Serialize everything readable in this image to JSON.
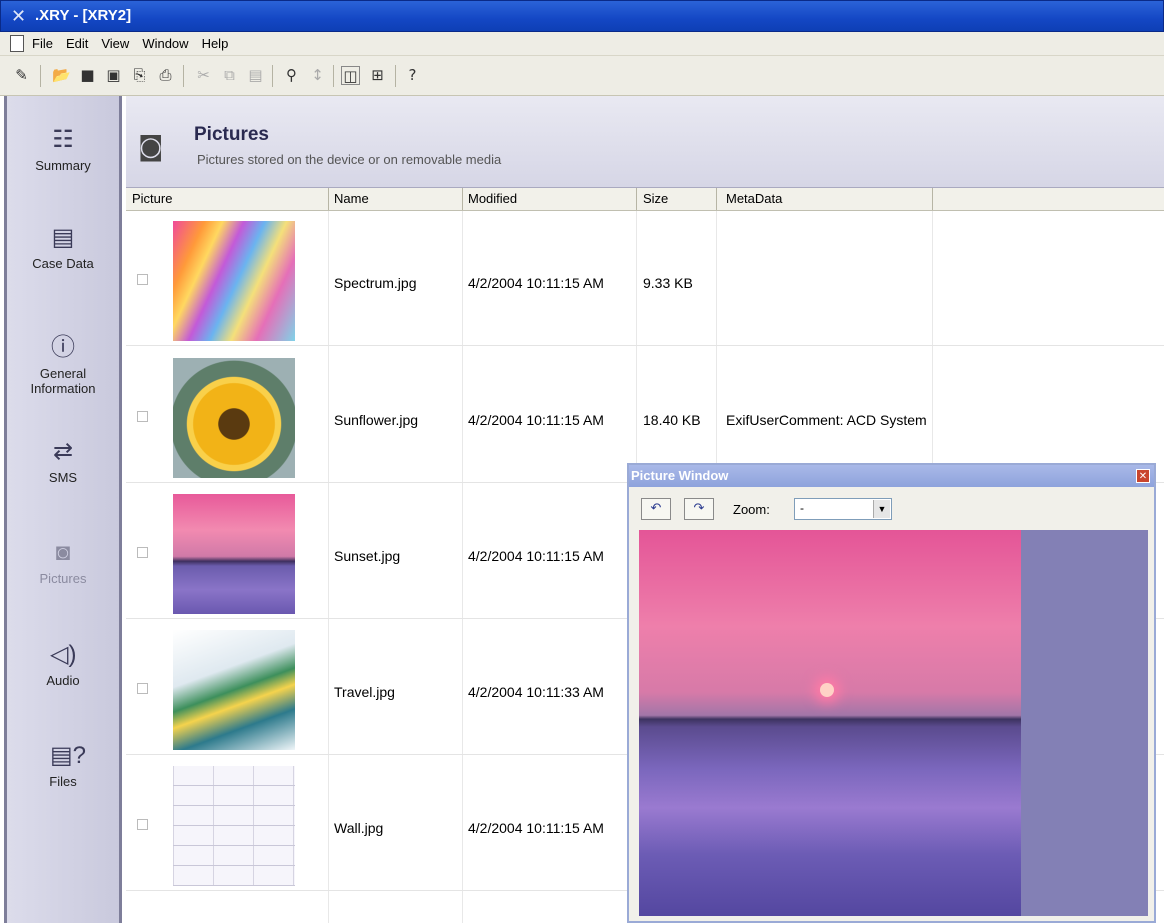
{
  "window": {
    "title": ".XRY - [XRY2]"
  },
  "menu": [
    "File",
    "Edit",
    "View",
    "Window",
    "Help"
  ],
  "toolbar_icons": [
    "wand-icon",
    "open-icon",
    "save-icon",
    "save-as-icon",
    "export-icon",
    "print-icon",
    "cut-icon",
    "copy-icon",
    "paste-icon",
    "find-icon",
    "find-next-icon",
    "pictures-view-icon",
    "filter-icon",
    "help-icon"
  ],
  "sidebar": {
    "items": [
      {
        "label": "Summary",
        "icon": "summary-icon"
      },
      {
        "label": "Case Data",
        "icon": "case-data-icon"
      },
      {
        "label": "General Information",
        "icon": "info-icon"
      },
      {
        "label": "SMS",
        "icon": "sms-icon"
      },
      {
        "label": "Pictures",
        "icon": "pictures-icon"
      },
      {
        "label": "Audio",
        "icon": "audio-icon"
      },
      {
        "label": "Files",
        "icon": "files-icon"
      }
    ]
  },
  "header": {
    "title": "Pictures",
    "subtitle": "Pictures stored on the device or on removable media"
  },
  "table": {
    "columns": [
      "Picture",
      "Name",
      "Modified",
      "Size",
      "MetaData"
    ],
    "rows": [
      {
        "name": "Spectrum.jpg",
        "modified": "4/2/2004 10:11:15 AM",
        "size": "9.33 KB",
        "meta": ""
      },
      {
        "name": "Sunflower.jpg",
        "modified": "4/2/2004 10:11:15 AM",
        "size": "18.40 KB",
        "meta": "ExifUserComment: ACD System"
      },
      {
        "name": "Sunset.jpg",
        "modified": "4/2/2004 10:11:15 AM",
        "size": "",
        "meta": ""
      },
      {
        "name": "Travel.jpg",
        "modified": "4/2/2004 10:11:33 AM",
        "size": "",
        "meta": ""
      },
      {
        "name": "Wall.jpg",
        "modified": "4/2/2004 10:11:15 AM",
        "size": "",
        "meta": ""
      }
    ]
  },
  "picture_window": {
    "title": "Picture Window",
    "zoom_label": "Zoom:",
    "zoom_value": "-"
  }
}
